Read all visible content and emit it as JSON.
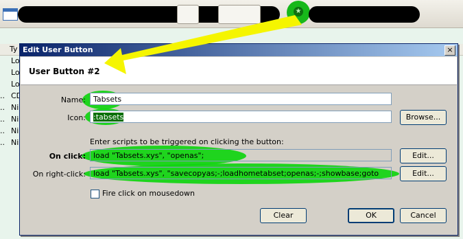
{
  "dialog": {
    "title": "Edit User Button",
    "close": "×",
    "header": "User Button #2",
    "name_label": "Name:",
    "name_value": "Tabsets",
    "icon_label": "Icon:",
    "icon_value": ":tabsets",
    "browse_label": "Browse...",
    "scripts_hint": "Enter scripts to be triggered on clicking the button:",
    "onclick_label": "On click:",
    "onclick_value": "load \"Tabsets.xys\", \"openas\";",
    "onrightclick_label": "On right-click:",
    "onrightclick_value": "load \"Tabsets.xys\", \"savecopyas;-;loadhometabset;openas;-;showbase;goto",
    "edit_label": "Edit...",
    "fire_label": "Fire click on mousedown",
    "clear_label": "Clear",
    "ok_label": "OK",
    "cancel_label": "Cancel"
  },
  "background": {
    "column_header": "Ty",
    "rows": [
      {
        "dots": "",
        "text": "Lo"
      },
      {
        "dots": "",
        "text": "Lo"
      },
      {
        "dots": "",
        "text": "Lo"
      },
      {
        "dots": "..",
        "text": "CD"
      },
      {
        "dots": "..",
        "text": "Ni"
      },
      {
        "dots": "..",
        "text": "Ni"
      },
      {
        "dots": "..",
        "text": "Ni"
      },
      {
        "dots": "..",
        "text": "Ni"
      }
    ]
  },
  "colors": {
    "highlight": "#0fd40f",
    "arrow": "#f5f500",
    "titlebar": "#0a246a"
  },
  "icons": {
    "toolbar_app": "window-icon",
    "user_button": "green-star-icon",
    "annotation": "yellow-arrow"
  }
}
